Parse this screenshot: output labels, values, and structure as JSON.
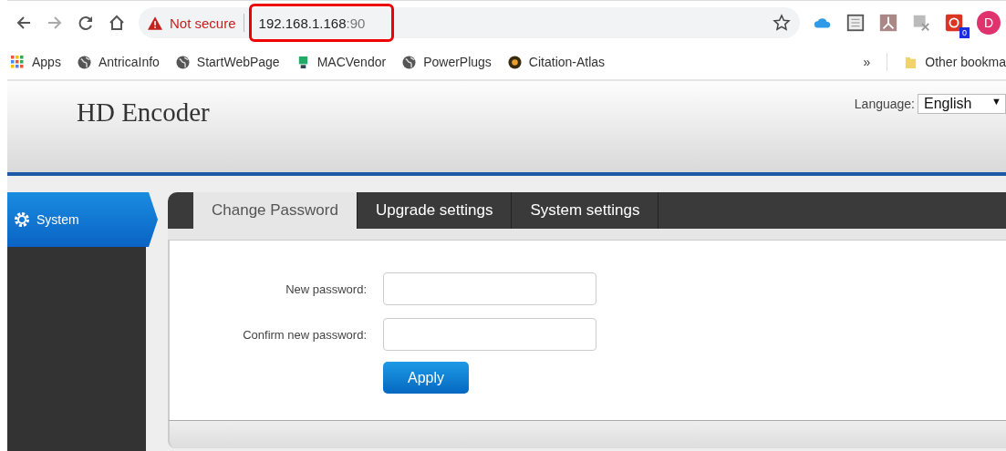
{
  "browser": {
    "security": "Not secure",
    "url_host": "192.168.1.168",
    "url_port": ":90",
    "extension_badge": "0",
    "avatar": "D",
    "bookmarks": [
      {
        "label": "Apps",
        "kind": "apps"
      },
      {
        "label": "AntricaInfo",
        "kind": "globe"
      },
      {
        "label": "StartWebPage",
        "kind": "globe"
      },
      {
        "label": "MACVendor",
        "kind": "pc"
      },
      {
        "label": "PowerPlugs",
        "kind": "globe"
      },
      {
        "label": "Citation-Atlas",
        "kind": "amazon"
      }
    ],
    "overflow": "»",
    "other_bookmarks": "Other bookma"
  },
  "header": {
    "title": "HD Encoder",
    "language_label": "Language:",
    "language_value": "English",
    "language_caret": "▼"
  },
  "sidebar": {
    "items": [
      {
        "label": "System",
        "selected": true
      }
    ]
  },
  "tabs": [
    {
      "label": "Change Password",
      "selected": true
    },
    {
      "label": "Upgrade settings",
      "selected": false
    },
    {
      "label": "System settings",
      "selected": false
    }
  ],
  "form": {
    "fields": [
      {
        "label": "New password:"
      },
      {
        "label": "Confirm new password:"
      }
    ],
    "button": "Apply"
  }
}
